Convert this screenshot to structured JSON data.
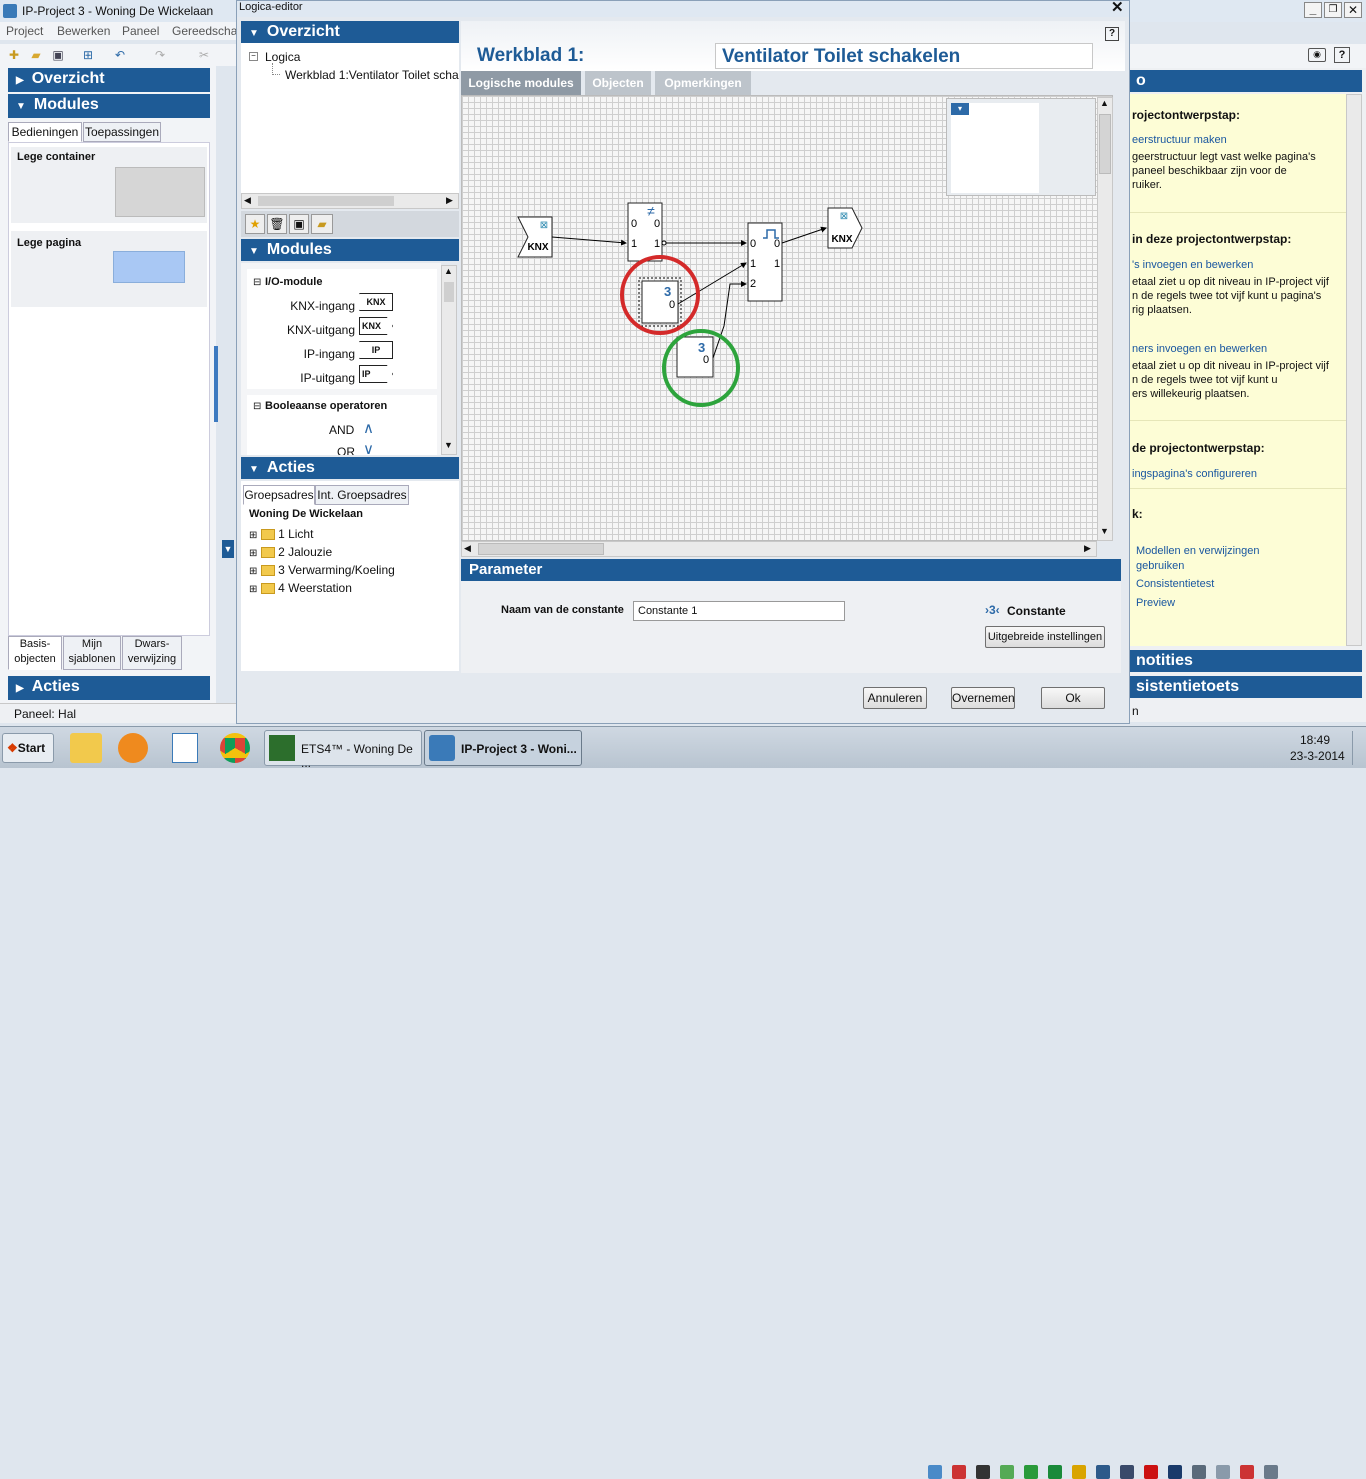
{
  "main_window": {
    "title": "IP-Project 3 - Woning De Wickelaan",
    "menu": [
      "Project",
      "Bewerken",
      "Paneel",
      "Gereedscha"
    ],
    "left": {
      "overzicht": "Overzicht",
      "modules": "Modules",
      "tabs": [
        "Bedieningen",
        "Toepassingen"
      ],
      "items": [
        {
          "label": "Lege container"
        },
        {
          "label": "Lege pagina"
        }
      ],
      "bottom_tabs": [
        "Basis-objecten",
        "Mijn sjablonen",
        "Dwars-verwijzing"
      ],
      "acties": "Acties",
      "status": "Paneel: Hal"
    },
    "right": {
      "h1": "rojectontwerpstap:",
      "l1": "eerstructuur maken",
      "t1": [
        "geerstructuur legt vast welke pagina's",
        "paneel beschikbaar zijn voor de",
        "ruiker."
      ],
      "h2": "in deze projectontwerpstap:",
      "l2": "'s invoegen en bewerken",
      "t2": [
        "etaal ziet u op dit niveau in IP-project vijf",
        "n de regels twee tot vijf kunt u pagina's",
        "rig plaatsen."
      ],
      "l3": "ners invoegen en bewerken",
      "t3": [
        "etaal ziet u op dit niveau in IP-project vijf",
        "n de regels twee tot vijf kunt u",
        "ers willekeurig plaatsen."
      ],
      "h3": "de projectontwerpstap:",
      "l4": "ingspagina's configureren",
      "h4": "k:",
      "links": [
        "Modellen en verwijzingen",
        "gebruiken",
        "Consistentietest",
        "Preview"
      ],
      "notities": "notities",
      "consist": "sistentietoets",
      "status": "n"
    }
  },
  "dialog": {
    "title": "Logica-editor",
    "overzicht": {
      "header": "Overzicht",
      "tree_root": "Logica",
      "tree_child": "Werkblad 1:Ventilator Toilet scha"
    },
    "modules": {
      "header": "Modules",
      "group1": "I/O-module",
      "items": [
        {
          "label": "KNX-ingang",
          "icon": "KNX"
        },
        {
          "label": "KNX-uitgang",
          "icon": "KNX"
        },
        {
          "label": "IP-ingang",
          "icon": "IP"
        },
        {
          "label": "IP-uitgang",
          "icon": "IP"
        }
      ],
      "group2": "Booleaanse operatoren",
      "and_label": "AND",
      "or_label": "OR"
    },
    "acties": {
      "header": "Acties",
      "tabs": [
        "Groepsadres",
        "Int. Groepsadres"
      ],
      "root": "Woning De Wickelaan",
      "folders": [
        "1 Licht",
        "2 Jalouzie",
        "3 Verwarming/Koeling",
        "4 Weerstation"
      ]
    },
    "worksheet": {
      "label": "Werkblad 1:",
      "name": "Ventilator Toilet schakelen",
      "tabs": [
        "Logische modules",
        "Objecten",
        "Opmerkingen"
      ]
    },
    "diagram": {
      "knx_in": "KNX",
      "knx_out": "KNX",
      "ne_symbol": "≠",
      "ne_in0": "0",
      "ne_in1": "1",
      "ne_out0": "0",
      "ne_out1": "1",
      "pulse_in0": "0",
      "pulse_in1": "1",
      "pulse_in2": "2",
      "pulse_out0": "0",
      "pulse_out1": "1",
      "const1": "3",
      "const1_out": "0",
      "const2": "3",
      "const2_out": "0"
    },
    "parameter": {
      "header": "Parameter",
      "field_label": "Naam van de constante",
      "field_value": "Constante 1",
      "type_label": "Constante",
      "adv_button": "Uitgebreide instellingen"
    },
    "buttons": {
      "cancel": "Annuleren",
      "apply": "Overnemen",
      "ok": "Ok"
    }
  },
  "taskbar": {
    "start": "Start",
    "tasks": [
      "ETS4™ - Woning De ...",
      "IP-Project 3 - Woni..."
    ],
    "time": "18:49",
    "date": "23-3-2014"
  }
}
